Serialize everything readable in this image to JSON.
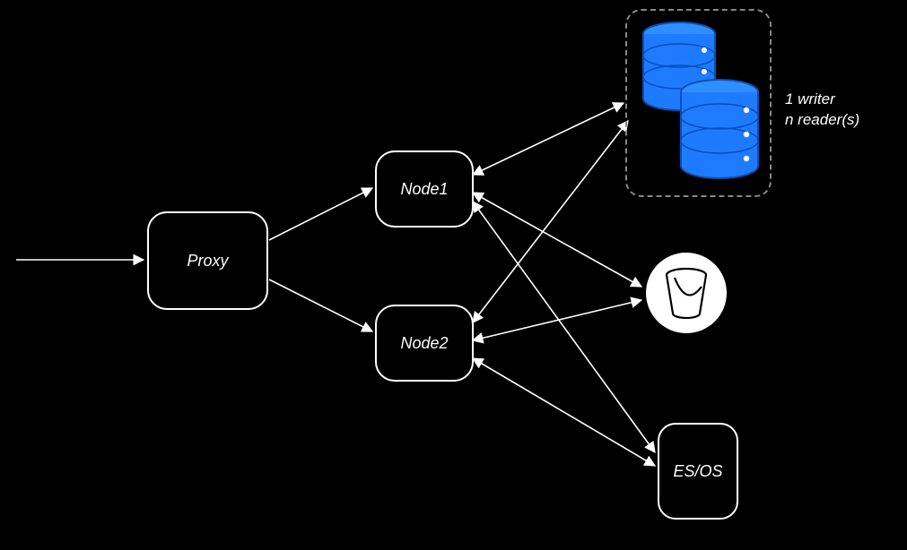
{
  "diagram": {
    "proxy_label": "Proxy",
    "node1_label": "Node1",
    "node2_label": "Node2",
    "esos_label": "ES/OS",
    "db_label_line1": "1 writer",
    "db_label_line2": "n reader(s)"
  },
  "components": {
    "proxy": "proxy-box",
    "node1": "node1-box",
    "node2": "node2-box",
    "db_cluster": "database-cluster",
    "bucket": "storage-bucket",
    "search": "elasticsearch-opensearch"
  },
  "arrows": [
    {
      "from": "entry",
      "to": "proxy",
      "dir": "one"
    },
    {
      "from": "proxy",
      "to": "node1",
      "dir": "one"
    },
    {
      "from": "proxy",
      "to": "node2",
      "dir": "one"
    },
    {
      "from": "node1",
      "to": "db_cluster",
      "dir": "both"
    },
    {
      "from": "node2",
      "to": "db_cluster",
      "dir": "both"
    },
    {
      "from": "node1",
      "to": "bucket",
      "dir": "both"
    },
    {
      "from": "node2",
      "to": "bucket",
      "dir": "both"
    },
    {
      "from": "node1",
      "to": "search",
      "dir": "both"
    },
    {
      "from": "node2",
      "to": "search",
      "dir": "both"
    }
  ]
}
